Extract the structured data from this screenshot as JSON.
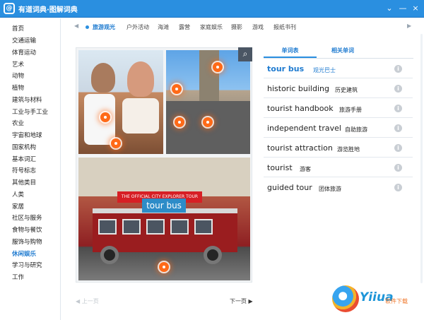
{
  "window": {
    "logo_glyph": "@",
    "title": "有道词典·图解词典",
    "controls": {
      "menu": "⌄",
      "minimize": "—",
      "close": "×"
    }
  },
  "sidebar": {
    "items": [
      {
        "label": "首页"
      },
      {
        "label": "交通运输"
      },
      {
        "label": "体育运动"
      },
      {
        "label": "艺术"
      },
      {
        "label": "动物"
      },
      {
        "label": "植物"
      },
      {
        "label": "建筑与材料"
      },
      {
        "label": "工业与手工业"
      },
      {
        "label": "农业"
      },
      {
        "label": "宇宙和地球"
      },
      {
        "label": "国家机构"
      },
      {
        "label": "基本词汇"
      },
      {
        "label": "符号标志"
      },
      {
        "label": "其他类目"
      },
      {
        "label": "人类"
      },
      {
        "label": "家居"
      },
      {
        "label": "社区与服务"
      },
      {
        "label": "食物与餐饮"
      },
      {
        "label": "服饰与购物"
      },
      {
        "label": "休闲娱乐",
        "active": true
      },
      {
        "label": "学习与研究"
      },
      {
        "label": "工作"
      }
    ]
  },
  "subnav": {
    "prev_arrow": "◀",
    "next_arrow": "▶",
    "tabs": [
      {
        "label": "旅游观光",
        "active": true
      },
      {
        "label": "户外活动"
      },
      {
        "label": "海滩"
      },
      {
        "label": "露营"
      },
      {
        "label": "家庭娱乐"
      },
      {
        "label": "摄影"
      },
      {
        "label": "游戏"
      },
      {
        "label": "报纸书刊"
      }
    ]
  },
  "picture": {
    "zoom_glyph": "⌕",
    "caption": "tour bus",
    "bus_sign": "THE OFFICIAL CITY EXPLORER TOUR",
    "pager": {
      "prev_label": "◀ 上一页",
      "next_label": "下一页 ▶"
    }
  },
  "word_panel": {
    "tabs": {
      "wordlist": "单词表",
      "related": "相关单词"
    },
    "info_glyph": "i",
    "entries": [
      {
        "en": "tour bus",
        "cn": "观光巴士",
        "selected": true
      },
      {
        "en": "historic building",
        "cn": "历史建筑"
      },
      {
        "en": "tourist handbook",
        "cn": "旅游手册"
      },
      {
        "en": "independent travel",
        "cn": "自助旅游"
      },
      {
        "en": "tourist attraction",
        "cn": "游览胜地"
      },
      {
        "en": "tourist",
        "cn": "游客"
      },
      {
        "en": "guided tour",
        "cn": "团体旅游"
      }
    ]
  },
  "watermark": {
    "brand": "Yiiua",
    "sub": "软件下载"
  },
  "colors": {
    "accent": "#2a8fe0",
    "hotspot": "#ff6a18",
    "caption_bg": "#2d8cc8"
  }
}
